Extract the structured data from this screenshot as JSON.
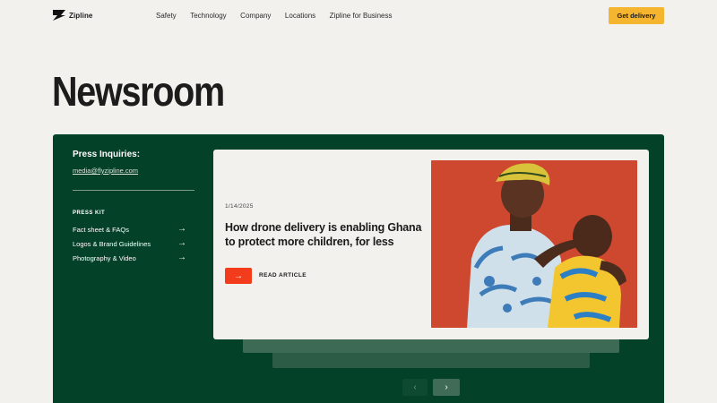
{
  "nav": {
    "brand": "Zipline",
    "links": [
      "Safety",
      "Technology",
      "Company",
      "Locations",
      "Zipline for Business"
    ],
    "cta_label": "Get delivery"
  },
  "page": {
    "title": "Newsroom"
  },
  "press": {
    "heading": "Press Inquiries:",
    "email": "media@flyzipline.com",
    "kit_heading": "PRESS KIT",
    "kit_items": [
      {
        "label": "Fact sheet & FAQs",
        "icon": "arrow-right-icon"
      },
      {
        "label": "Logos & Brand Guidelines",
        "icon": "arrow-right-icon"
      },
      {
        "label": "Photography & Video",
        "icon": "arrow-right-icon"
      }
    ]
  },
  "featured": {
    "date": "1/14/2025",
    "title": "How drone delivery is enabling Ghana to protect more children, for less",
    "read_label": "READ ARTICLE",
    "read_icon": "arrow-right-icon",
    "image": "mother-feeding-child-photo"
  },
  "pagination": {
    "prev": "‹",
    "next": "›"
  },
  "colors": {
    "panel": "#044129",
    "accent": "#f23c1c",
    "cta": "#f5b52e",
    "background": "#f2f1ee"
  }
}
